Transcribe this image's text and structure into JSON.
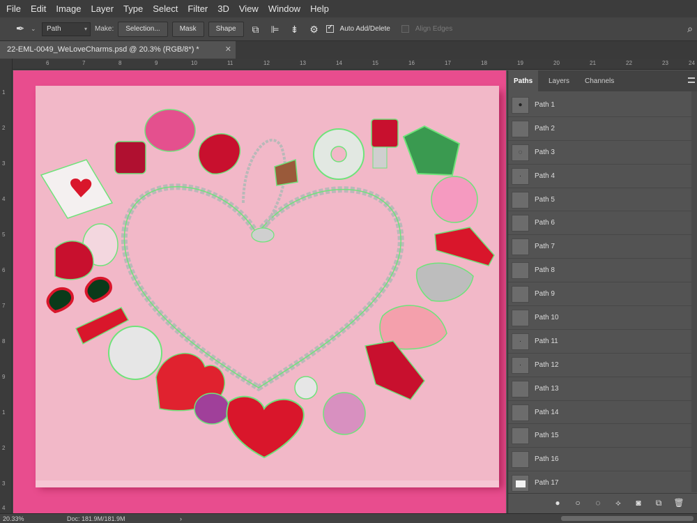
{
  "menu": [
    "File",
    "Edit",
    "Image",
    "Layer",
    "Type",
    "Select",
    "Filter",
    "3D",
    "View",
    "Window",
    "Help"
  ],
  "options": {
    "tool_icon": "pen-tool-icon",
    "mode": "Path",
    "make_label": "Make:",
    "selection_btn": "Selection...",
    "mask_btn": "Mask",
    "shape_btn": "Shape",
    "auto_add_delete": "Auto Add/Delete",
    "align_edges": "Align Edges"
  },
  "document": {
    "tab_title": "22-EML-0049_WeLoveCharms.psd @ 20.3% (RGB/8*) *"
  },
  "ruler": {
    "top_ticks": [
      "6",
      "7",
      "8",
      "9",
      "10",
      "11",
      "12",
      "13",
      "14",
      "15",
      "16",
      "17",
      "18",
      "19",
      "20",
      "21",
      "22",
      "23",
      "24"
    ],
    "left_ticks": [
      "1",
      "2",
      "3",
      "4",
      "5",
      "6",
      "7",
      "8",
      "9",
      "1",
      "2",
      "3",
      "4"
    ]
  },
  "panel": {
    "tabs": [
      "Paths",
      "Layers",
      "Channels"
    ],
    "active_tab": "Paths",
    "paths": [
      "Path 1",
      "Path 2",
      "Path 3",
      "Path 4",
      "Path 5",
      "Path 6",
      "Path 7",
      "Path 8",
      "Path 9",
      "Path 10",
      "Path 11",
      "Path 12",
      "Path 13",
      "Path 14",
      "Path 15",
      "Path 16",
      "Path 17"
    ]
  },
  "status": {
    "zoom": "20.33%",
    "doc": "Doc: 181.9M/181.9M"
  },
  "colors": {
    "background_magenta": "#e84d8e",
    "board_pink": "#f2b8c8",
    "path_green": "#6fe37a",
    "enamel_red": "#d9162b"
  }
}
